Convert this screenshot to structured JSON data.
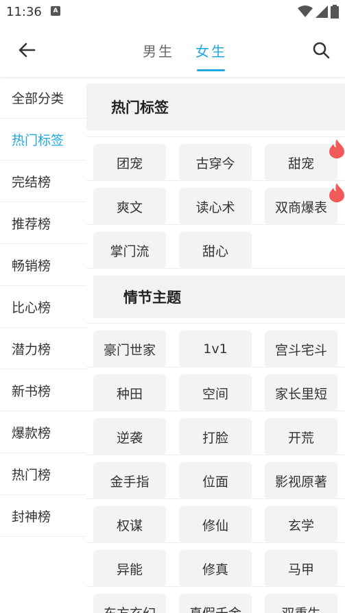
{
  "status_bar": {
    "time": "11:36",
    "notif_glyph": "A",
    "icons": [
      "wifi-icon",
      "signal-icon",
      "battery-icon"
    ]
  },
  "header": {
    "tabs": [
      {
        "label": "男生"
      },
      {
        "label": "女生"
      }
    ],
    "active_tab": "女生",
    "accent_color": "#1ea8e0"
  },
  "sidebar": {
    "items": [
      {
        "label": "全部分类"
      },
      {
        "label": "热门标签"
      },
      {
        "label": "完结榜"
      },
      {
        "label": "推荐榜"
      },
      {
        "label": "畅销榜"
      },
      {
        "label": "比心榜"
      },
      {
        "label": "潜力榜"
      },
      {
        "label": "新书榜"
      },
      {
        "label": "爆款榜"
      },
      {
        "label": "热门榜"
      },
      {
        "label": "封神榜"
      }
    ],
    "active_index": 1
  },
  "sections": {
    "hot": {
      "title": "热门标签",
      "rows": [
        [
          "团宠",
          "古穿今",
          "甜宠"
        ],
        [
          "爽文",
          "读心术",
          "双商爆表"
        ],
        [
          "掌门流",
          "甜心"
        ]
      ],
      "hot_badges": [
        "fire-icon",
        "fire-icon"
      ]
    },
    "plot": {
      "title": "情节主题",
      "rows": [
        [
          "豪门世家",
          "1v1",
          "宫斗宅斗"
        ],
        [
          "种田",
          "空间",
          "家长里短"
        ],
        [
          "逆袭",
          "打脸",
          "开荒"
        ],
        [
          "金手指",
          "位面",
          "影视原著"
        ],
        [
          "权谋",
          "修仙",
          "玄学"
        ],
        [
          "异能",
          "修真",
          "马甲"
        ],
        [
          "东方玄幻",
          "真假千金",
          "双重生"
        ]
      ]
    }
  }
}
